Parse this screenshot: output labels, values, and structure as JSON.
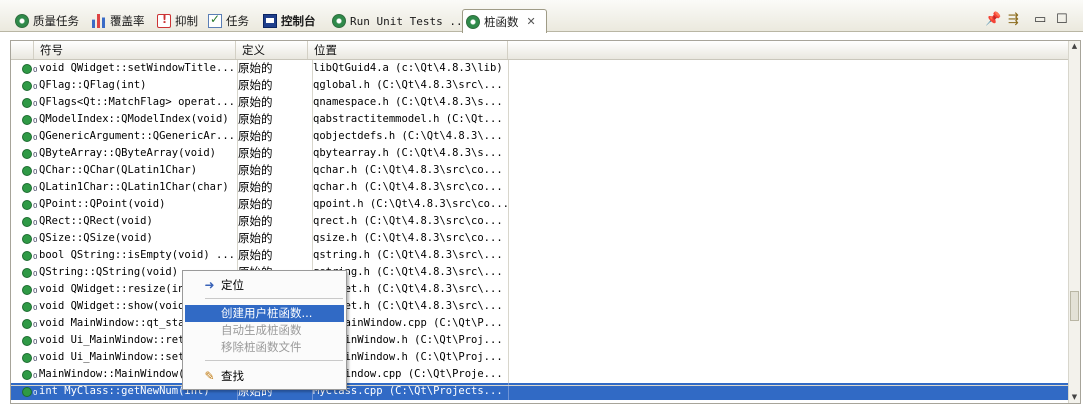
{
  "tabs": [
    {
      "id": "quality",
      "label": "质量任务",
      "icon": "quality-gear-icon"
    },
    {
      "id": "coverage",
      "label": "覆盖率",
      "icon": "coverage-chart-icon"
    },
    {
      "id": "suppress",
      "label": "抑制",
      "icon": "suppress-warning-icon"
    },
    {
      "id": "tasks",
      "label": "任务",
      "icon": "task-check-icon"
    },
    {
      "id": "console",
      "label": "控制台",
      "icon": "console-icon"
    },
    {
      "id": "rununit",
      "label": "Run Unit Tests ...",
      "icon": "run-tests-gear-icon"
    },
    {
      "id": "stub",
      "label": "桩函数",
      "icon": "stub-gear-icon",
      "active": true
    }
  ],
  "toolbar": {
    "pin": "📌",
    "menu": "⇶",
    "minimize": "▭",
    "maximize": "☐"
  },
  "table": {
    "headers": {
      "symbol": "符号",
      "definition": "定义",
      "location": "位置"
    },
    "rows": [
      {
        "symbol": "void QWidget::setWindowTitle...",
        "definition": "原始的",
        "location": "libQtGuid4.a  (c:\\Qt\\4.8.3\\lib)"
      },
      {
        "symbol": "QFlag::QFlag(int)",
        "definition": "原始的",
        "location": "qglobal.h  (C:\\Qt\\4.8.3\\src\\..."
      },
      {
        "symbol": "QFlags<Qt::MatchFlag> operat...",
        "definition": "原始的",
        "location": "qnamespace.h  (C:\\Qt\\4.8.3\\s..."
      },
      {
        "symbol": "QModelIndex::QModelIndex(void)",
        "definition": "原始的",
        "location": "qabstractitemmodel.h  (C:\\Qt..."
      },
      {
        "symbol": "QGenericArgument::QGenericAr...",
        "definition": "原始的",
        "location": "qobjectdefs.h  (C:\\Qt\\4.8.3\\..."
      },
      {
        "symbol": "QByteArray::QByteArray(void)",
        "definition": "原始的",
        "location": "qbytearray.h  (C:\\Qt\\4.8.3\\s..."
      },
      {
        "symbol": "QChar::QChar(QLatin1Char)",
        "definition": "原始的",
        "location": "qchar.h  (C:\\Qt\\4.8.3\\src\\co..."
      },
      {
        "symbol": "QLatin1Char::QLatin1Char(char)",
        "definition": "原始的",
        "location": "qchar.h  (C:\\Qt\\4.8.3\\src\\co..."
      },
      {
        "symbol": "QPoint::QPoint(void)",
        "definition": "原始的",
        "location": "qpoint.h  (C:\\Qt\\4.8.3\\src\\co..."
      },
      {
        "symbol": "QRect::QRect(void)",
        "definition": "原始的",
        "location": "qrect.h  (C:\\Qt\\4.8.3\\src\\co..."
      },
      {
        "symbol": "QSize::QSize(void)",
        "definition": "原始的",
        "location": "qsize.h  (C:\\Qt\\4.8.3\\src\\co..."
      },
      {
        "symbol": "bool QString::isEmpty(void) ...",
        "definition": "原始的",
        "location": "qstring.h  (C:\\Qt\\4.8.3\\src\\..."
      },
      {
        "symbol": "QString::QString(void)",
        "definition": "原始的",
        "location": "qstring.h  (C:\\Qt\\4.8.3\\src\\..."
      },
      {
        "symbol": "void QWidget::resize(int",
        "definition": "",
        "location": "qwidget.h  (C:\\Qt\\4.8.3\\src\\..."
      },
      {
        "symbol": "void QWidget::show(void)",
        "definition": "",
        "location": "qwidget.h  (C:\\Qt\\4.8.3\\src\\..."
      },
      {
        "symbol": "void MainWindow::qt_stat",
        "definition": "",
        "location": "moc_mainWindow.cpp  (C:\\Qt\\P..."
      },
      {
        "symbol": "void Ui_MainWindow::retr",
        "definition": "",
        "location": "ui_mainWindow.h  (C:\\Qt\\Proj..."
      },
      {
        "symbol": "void Ui_MainWindow::setu",
        "definition": "",
        "location": "ui_mainWindow.h  (C:\\Qt\\Proj..."
      },
      {
        "symbol": "MainWindow::MainWindow(Q",
        "definition": "",
        "location": "mainWindow.cpp  (C:\\Qt\\Proje..."
      },
      {
        "symbol": "int MyClass::getNewNum(int)",
        "definition": "原始的",
        "location": "MyClass.cpp  (C:\\Qt\\Projects...",
        "selected": true
      }
    ]
  },
  "context_menu": {
    "items": [
      {
        "id": "locate",
        "label": "定位",
        "icon": "locate-arrow-icon",
        "state": "normal"
      },
      {
        "id": "create",
        "label": "创建用户桩函数...",
        "state": "highlighted"
      },
      {
        "id": "autogen",
        "label": "自动生成桩函数",
        "state": "disabled"
      },
      {
        "id": "remove",
        "label": "移除桩函数文件",
        "state": "disabled"
      },
      {
        "id": "find",
        "label": "查找",
        "icon": "find-flashlight-icon",
        "state": "normal"
      }
    ]
  }
}
